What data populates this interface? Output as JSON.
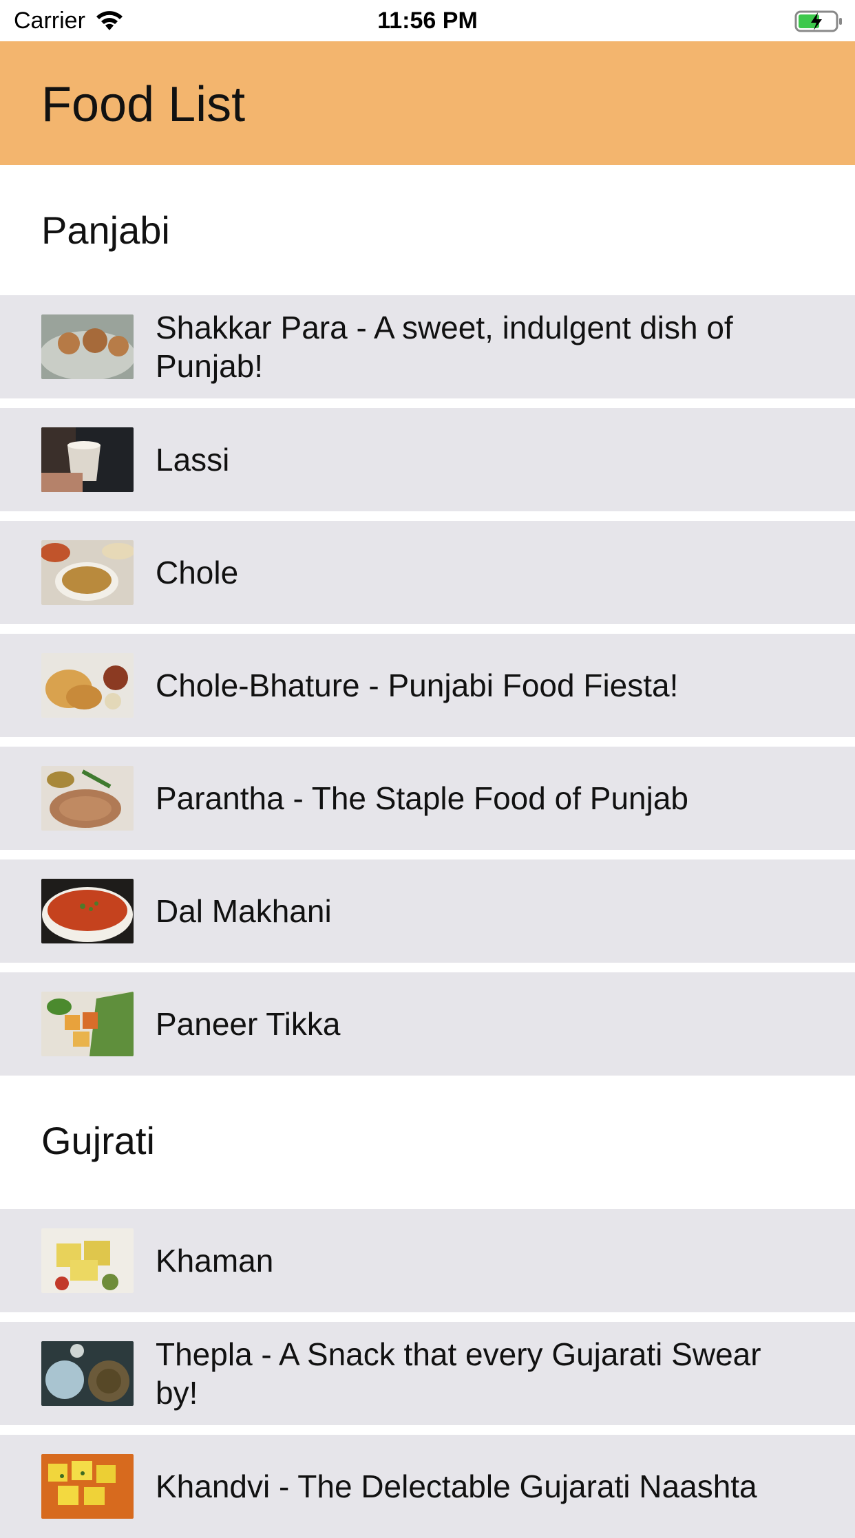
{
  "status_bar": {
    "carrier": "Carrier",
    "time": "11:56 PM",
    "wifi_icon": "wifi-icon",
    "battery_icon": "battery-charging-icon"
  },
  "navbar": {
    "title": "Food List",
    "color": "#F3B56E"
  },
  "sections": [
    {
      "title": "Panjabi",
      "items": [
        {
          "label": "Shakkar Para - A sweet, indulgent dish of Punjab!",
          "image": "shakkar-para-image"
        },
        {
          "label": "Lassi",
          "image": "lassi-image"
        },
        {
          "label": "Chole",
          "image": "chole-image"
        },
        {
          "label": "Chole-Bhature - Punjabi Food Fiesta!",
          "image": "chole-bhature-image"
        },
        {
          "label": "Parantha - The Staple Food of Punjab",
          "image": "parantha-image"
        },
        {
          "label": "Dal Makhani",
          "image": "dal-makhani-image"
        },
        {
          "label": "Paneer Tikka",
          "image": "paneer-tikka-image"
        }
      ]
    },
    {
      "title": "Gujrati",
      "items": [
        {
          "label": "Khaman",
          "image": "khaman-image"
        },
        {
          "label": "Thepla - A Snack that every Gujarati Swear by!",
          "image": "thepla-image"
        },
        {
          "label": "Khandvi - The Delectable Gujarati Naashta",
          "image": "khandvi-image"
        }
      ]
    }
  ],
  "colors": {
    "row_background": "#E6E5EA",
    "section_background": "#FFFFFF"
  }
}
